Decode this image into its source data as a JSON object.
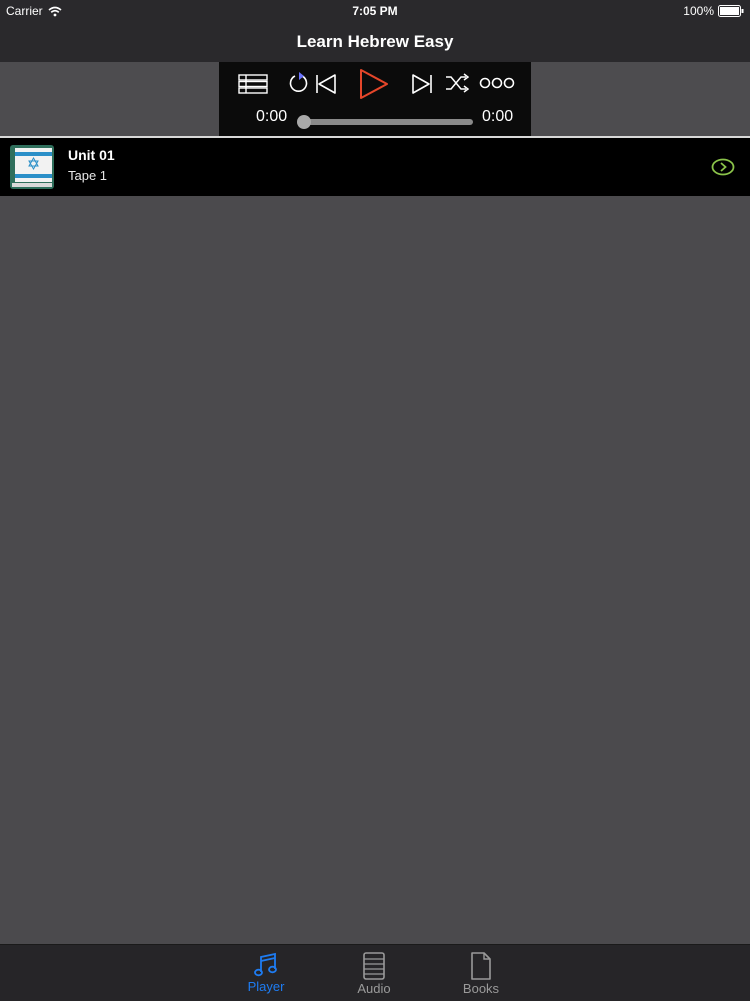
{
  "status": {
    "carrier": "Carrier",
    "time": "7:05 PM",
    "battery": "100%"
  },
  "nav": {
    "title": "Learn Hebrew Easy"
  },
  "player": {
    "elapsed": "0:00",
    "duration": "0:00",
    "progress": 0
  },
  "tracks": [
    {
      "title": "Unit 01",
      "subtitle": "Tape 1"
    }
  ],
  "tabs": [
    {
      "label": "Player",
      "active": true
    },
    {
      "label": "Audio",
      "active": false
    },
    {
      "label": "Books",
      "active": false
    }
  ],
  "colors": {
    "accent": "#1e7cf2",
    "play": "#e5462a",
    "disclosure": "#8bc34a",
    "inactive_tab": "#9a9a9a"
  }
}
